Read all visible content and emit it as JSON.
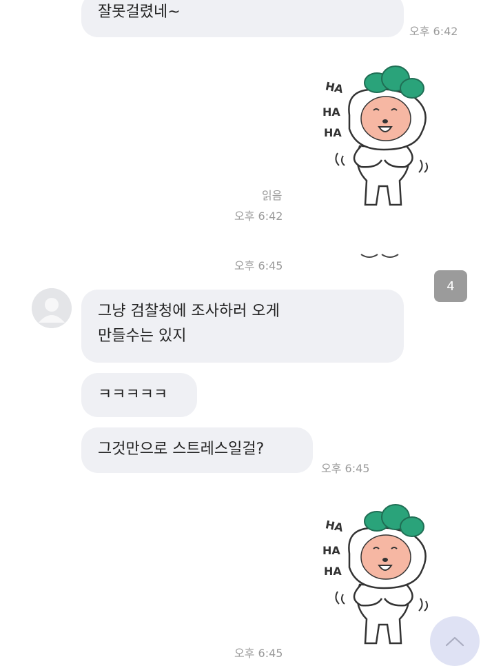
{
  "messages": {
    "m1": {
      "text": "잘못걸렸네~",
      "time": "오후 6:42"
    },
    "sticker1": {
      "read_label": "읽음",
      "time": "오후 6:42",
      "sticker_text": [
        "HA",
        "HA",
        "HA"
      ]
    },
    "divider_time": "오후 6:45",
    "unread_badge": "4",
    "m2": {
      "line1": "그냥 검찰청에 조사하러 오게",
      "line2": "만들수는 있지"
    },
    "m3": {
      "text": "ㅋㅋㅋㅋㅋ"
    },
    "m4": {
      "text": "그것만으로 스트레스일걸?",
      "time": "오후 6:45"
    },
    "sticker2": {
      "time": "오후 6:45",
      "sticker_text": [
        "HA",
        "HA",
        "HA"
      ]
    }
  },
  "icons": {
    "avatar": "default-avatar-icon",
    "scroll": "chevron-up-icon",
    "sticker": "laughing-character-sticker"
  },
  "colors": {
    "bubble": "#eff0f4",
    "time": "#9a9a9a",
    "badge": "#9b9b9b",
    "scroll_button": "#dfe2f4",
    "sticker_leaf": "#2aa37a",
    "sticker_face": "#f6b7a3"
  }
}
